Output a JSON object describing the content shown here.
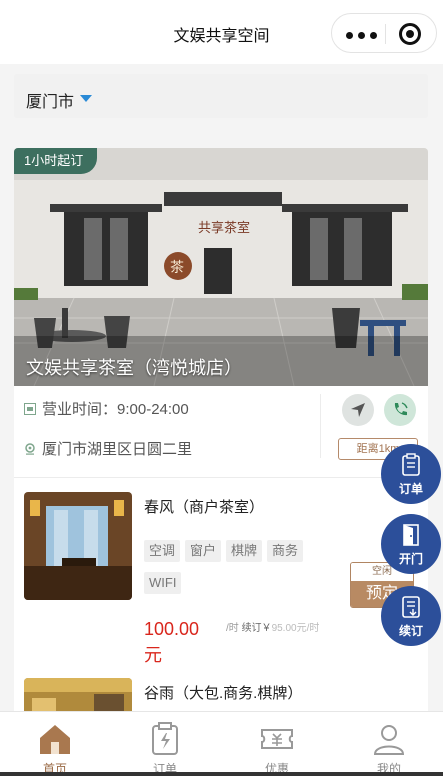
{
  "header": {
    "title": "文娱共享空间"
  },
  "city": {
    "name": "厦门市"
  },
  "shop": {
    "tag": "1小时起订",
    "name": "文娱共享茶室（湾悦城店）",
    "sign_text": "共享茶室",
    "sign_badge": "茶",
    "hours": "营业时间：9:00-24:00",
    "address": "厦门市湖里区日圆二里",
    "distance": "距离1km"
  },
  "rooms": [
    {
      "name": "春风（商户茶室）",
      "amenities": [
        "空调",
        "窗户",
        "棋牌",
        "商务",
        "WIFI"
      ],
      "price": "100.00元",
      "unit": "/时",
      "renew_label": "续订￥",
      "renew_value": "95.00元/时",
      "status": "空闲",
      "book_label": "预定"
    },
    {
      "name": "谷雨（大包.商务.棋牌）"
    }
  ],
  "fabs": {
    "orders": "订单",
    "open": "开门",
    "renew": "续订"
  },
  "tabs": [
    {
      "label": "首页",
      "icon": "home-icon",
      "active": true
    },
    {
      "label": "订单",
      "icon": "order-clipboard-icon",
      "active": false
    },
    {
      "label": "优惠",
      "icon": "coupon-icon",
      "active": false
    },
    {
      "label": "我的",
      "icon": "user-icon",
      "active": false
    }
  ],
  "colors": {
    "accent_brown": "#b88a63",
    "fab_blue": "#2c4f9a",
    "price_red": "#d9261c",
    "tag_green": "#3d6f5f",
    "caret_blue": "#2a8ad6"
  }
}
